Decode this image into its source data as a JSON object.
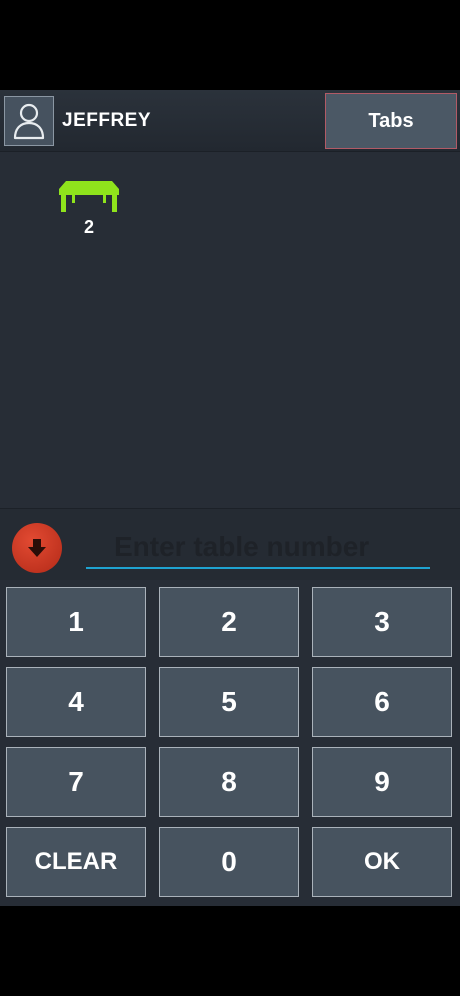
{
  "header": {
    "user_name": "JEFFREY",
    "tabs_label": "Tabs"
  },
  "floor": {
    "tables": [
      {
        "number": "2",
        "icon": "table-icon",
        "color": "#8fe31c"
      }
    ]
  },
  "entry": {
    "placeholder": "Enter table number",
    "value": "",
    "down_icon": "arrow-down-icon",
    "accent_color": "#1fa3d1"
  },
  "keypad": {
    "keys": [
      "1",
      "2",
      "3",
      "4",
      "5",
      "6",
      "7",
      "8",
      "9",
      "CLEAR",
      "0",
      "OK"
    ]
  },
  "colors": {
    "background": "#272d36",
    "key": "#47535f",
    "button_red": "#c8321e"
  }
}
